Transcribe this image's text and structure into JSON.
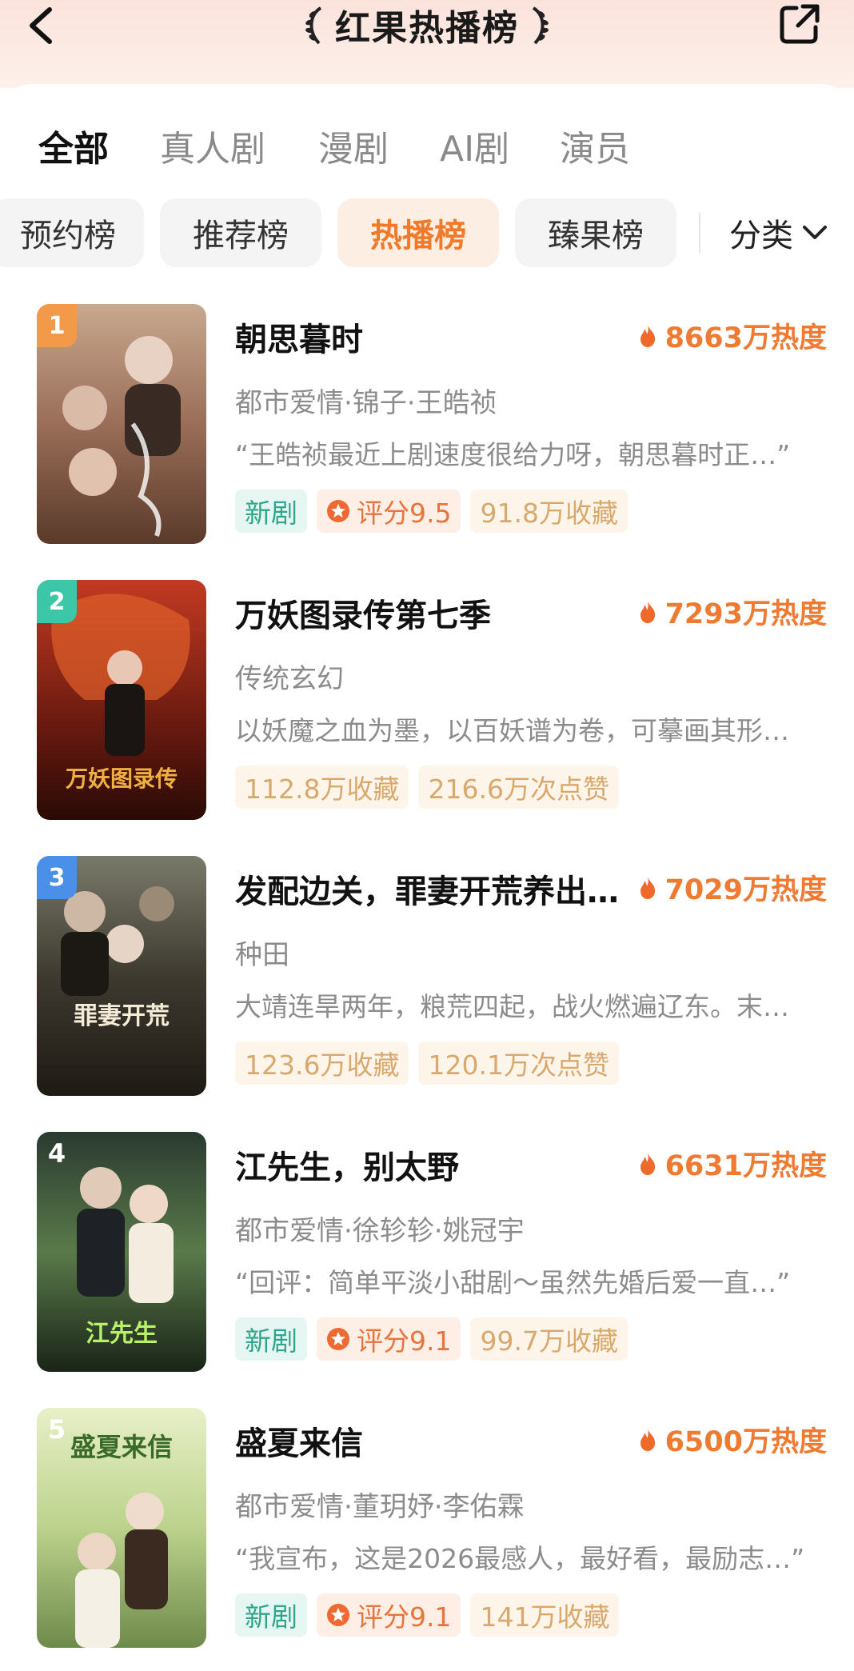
{
  "header": {
    "title": "红果热播榜"
  },
  "tabs": [
    "全部",
    "真人剧",
    "漫剧",
    "AI剧",
    "演员"
  ],
  "chips": [
    "预约榜",
    "推荐榜",
    "热播榜",
    "臻果榜"
  ],
  "category_label": "分类",
  "colors": {
    "accent": "#ef7a32",
    "new_tag": "#2fa58b",
    "rank1": "#f39a4a",
    "rank2": "#3cc8a8",
    "rank3": "#4a8fe8"
  },
  "items": [
    {
      "rank": "1",
      "title": "朝思暮时",
      "heat": "8663万热度",
      "meta": "都市爱情·锦子·王皓祯",
      "desc": "“王皓祯最近上剧速度很给力呀，朝思暮时正…”",
      "tag_new": "新剧",
      "tag_rating": "评分9.5",
      "tag_stat": "91.8万收藏"
    },
    {
      "rank": "2",
      "title": "万妖图录传第七季",
      "heat": "7293万热度",
      "meta": "传统玄幻",
      "desc": "以妖魔之血为墨，以百妖谱为卷，可摹画其形…",
      "tag_stat1": "112.8万收藏",
      "tag_stat2": "216.6万次点赞"
    },
    {
      "rank": "3",
      "title": "发配边关，罪妻开荒养出…",
      "heat": "7029万热度",
      "meta": "种田",
      "desc": "大靖连旱两年，粮荒四起，战火燃遍辽东。末…",
      "tag_stat1": "123.6万收藏",
      "tag_stat2": "120.1万次点赞"
    },
    {
      "rank": "4",
      "title": "江先生，别太野",
      "heat": "6631万热度",
      "meta": "都市爱情·徐轸轸·姚冠宇",
      "desc": "“回评：简单平淡小甜剧～虽然先婚后爱一直…”",
      "tag_new": "新剧",
      "tag_rating": "评分9.1",
      "tag_stat": "99.7万收藏"
    },
    {
      "rank": "5",
      "title": "盛夏来信",
      "heat": "6500万热度",
      "meta": "都市爱情·董玥妤·李佑霖",
      "desc": "“我宣布，这是2026最感人，最好看，最励志…”",
      "tag_new": "新剧",
      "tag_rating": "评分9.1",
      "tag_stat": "141万收藏"
    }
  ]
}
